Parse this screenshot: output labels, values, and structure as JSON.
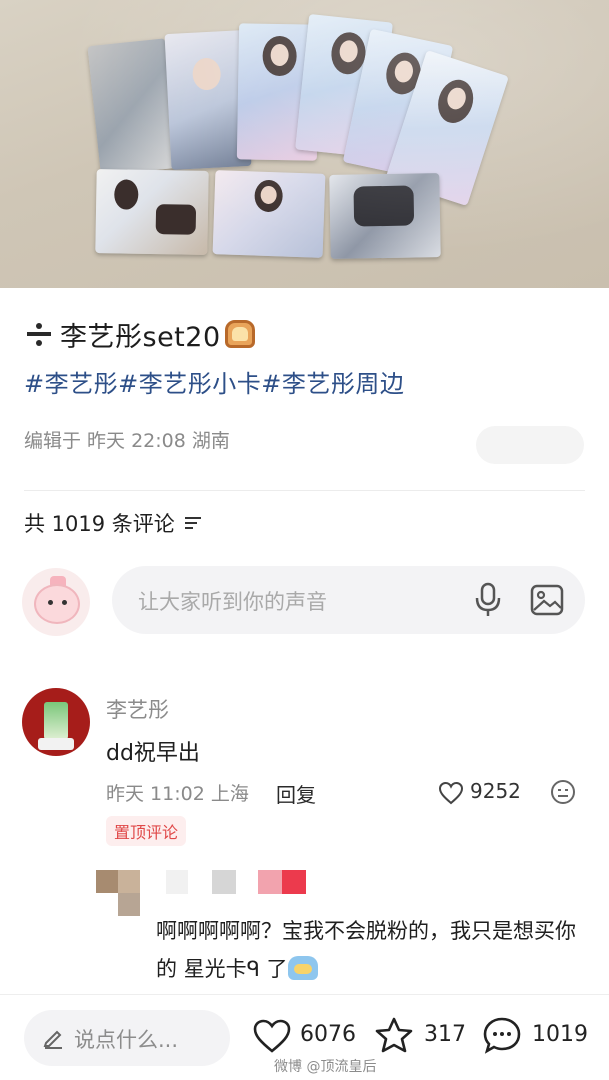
{
  "post": {
    "title": "李艺彤set20",
    "title_leading_icon": "divide-icon",
    "title_trailing_icon": "bread-icon",
    "tags": [
      "#李艺彤",
      "#李艺彤小卡",
      "#李艺彤周边"
    ],
    "meta": "编辑于 昨天 22:08 湖南"
  },
  "comments_header": {
    "label": "共 1019 条评论",
    "sort_icon": "sort-icon"
  },
  "composer": {
    "placeholder": "让大家听到你的声音",
    "icons": [
      "mic-icon",
      "image-icon"
    ]
  },
  "comment": {
    "author": "李艺彤",
    "text": "dd祝早出",
    "time_location": "昨天 11:02 上海",
    "reply_label": "回复",
    "like_count": "9252",
    "badge": "置顶评论"
  },
  "reply": {
    "text_part1": "啊啊啊啊啊？宝我不会脱粉的，我只是想买你的 ",
    "text_part2": "星光卡",
    "text_part3": "ᑫ 了"
  },
  "bottom_bar": {
    "say_placeholder": "说点什么...",
    "like_count": "6076",
    "star_count": "317",
    "comment_count": "1019"
  },
  "watermark": "微博 @顶流皇后",
  "colors": {
    "tag": "#2d4f88",
    "pin_badge_text": "#e04848",
    "pin_badge_bg": "#fdeeee"
  }
}
